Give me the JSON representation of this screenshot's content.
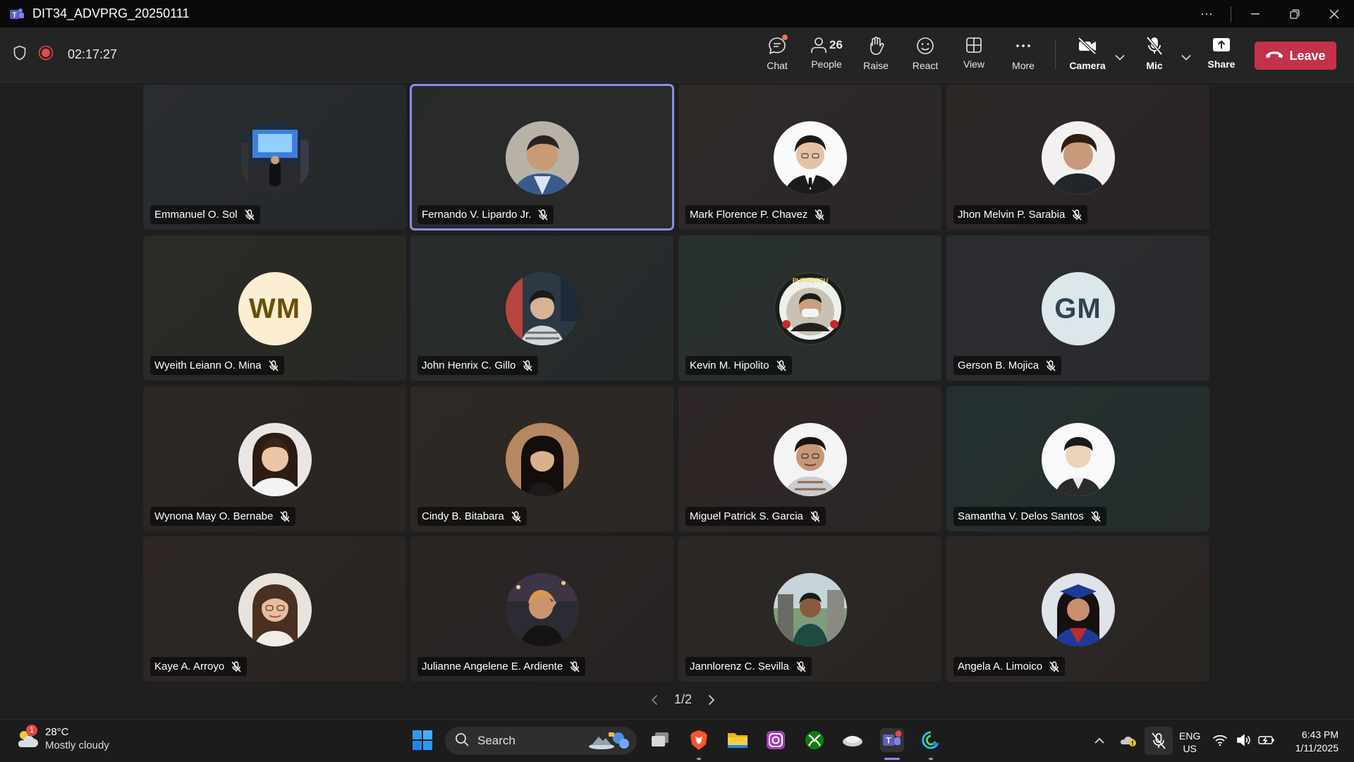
{
  "window": {
    "title": "DIT34_ADVPRG_20250111"
  },
  "meeting": {
    "timer": "02:17:27",
    "toolbar": {
      "chat": "Chat",
      "people": "People",
      "people_count": "26",
      "raise": "Raise",
      "react": "React",
      "view": "View",
      "more": "More",
      "camera": "Camera",
      "mic": "Mic",
      "share": "Share",
      "leave": "Leave"
    },
    "participants": [
      {
        "name": "Emmanuel O. Sol",
        "avatar": "photo-city-night"
      },
      {
        "name": "Fernando V. Lipardo Jr.",
        "avatar": "photo-man-glasses",
        "active": true
      },
      {
        "name": "Mark Florence P. Chavez",
        "avatar": "photo-man-suit"
      },
      {
        "name": "Jhon Melvin P. Sarabia",
        "avatar": "photo-man-dark-shirt"
      },
      {
        "name": "Wyeith Leiann O. Mina",
        "initials": "WM",
        "color": "#fbeed2",
        "textColor": "#6b4e08"
      },
      {
        "name": "John Henrix C. Gillo",
        "avatar": "photo-man-street"
      },
      {
        "name": "Kevin M. Hipolito",
        "avatar": "photo-badge-mask"
      },
      {
        "name": "Gerson B. Mojica",
        "initials": "GM",
        "color": "#dde6ea",
        "textColor": "#2d4452"
      },
      {
        "name": "Wynona May O. Bernabe",
        "avatar": "photo-woman-portrait"
      },
      {
        "name": "Cindy B. Bitabara",
        "avatar": "photo-woman-wood"
      },
      {
        "name": "Miguel Patrick S. Garcia",
        "avatar": "photo-man-smile"
      },
      {
        "name": "Samantha V. Delos Santos",
        "avatar": "photo-person-white"
      },
      {
        "name": "Kaye A. Arroyo",
        "avatar": "photo-woman-glasses"
      },
      {
        "name": "Julianne Angelene E. Ardiente",
        "avatar": "photo-woman-night"
      },
      {
        "name": "Jannlorenz C. Sevilla",
        "avatar": "photo-man-outdoor"
      },
      {
        "name": "Angela A. Limoico",
        "avatar": "photo-graduate"
      }
    ],
    "pager": "1/2"
  },
  "taskbar": {
    "weather_badge": "1",
    "temperature": "28°C",
    "condition": "Mostly cloudy",
    "search_label": "Search",
    "lang_primary": "ENG",
    "lang_secondary": "US",
    "time": "6:43 PM",
    "date": "1/11/2025"
  },
  "colors": {
    "accent": "#8b8fe8",
    "leave": "#c4314b",
    "record": "#e5484d"
  }
}
